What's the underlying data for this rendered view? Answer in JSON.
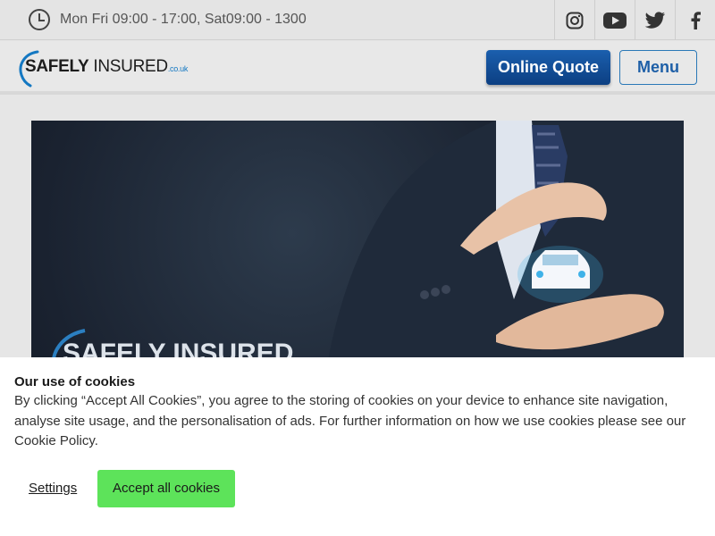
{
  "topbar": {
    "hours": "Mon Fri 09:00 - 17:00, Sat09:00 - 1300",
    "socials": [
      "instagram-icon",
      "youtube-icon",
      "twitter-icon",
      "facebook-icon"
    ]
  },
  "header": {
    "logo": {
      "brand": "SAFELY",
      "brand2": " INSURED",
      "domain": ".co.uk"
    },
    "quote_label": "Online Quote",
    "menu_label": "Menu"
  },
  "hero": {
    "logo_text": "SAFELY INSURED"
  },
  "cookie": {
    "title": "Our use of cookies",
    "body": "By clicking “Accept All Cookies”, you agree to the storing of cookies on your device to enhance site navigation, analyse site usage, and the personalisation of ads. For further information on how we use cookies please see our Cookie Policy.",
    "settings_label": "Settings",
    "accept_label": "Accept all cookies"
  },
  "colors": {
    "primary": "#0c3f82",
    "accent": "#1478c2",
    "accept_green": "#5de35a"
  }
}
